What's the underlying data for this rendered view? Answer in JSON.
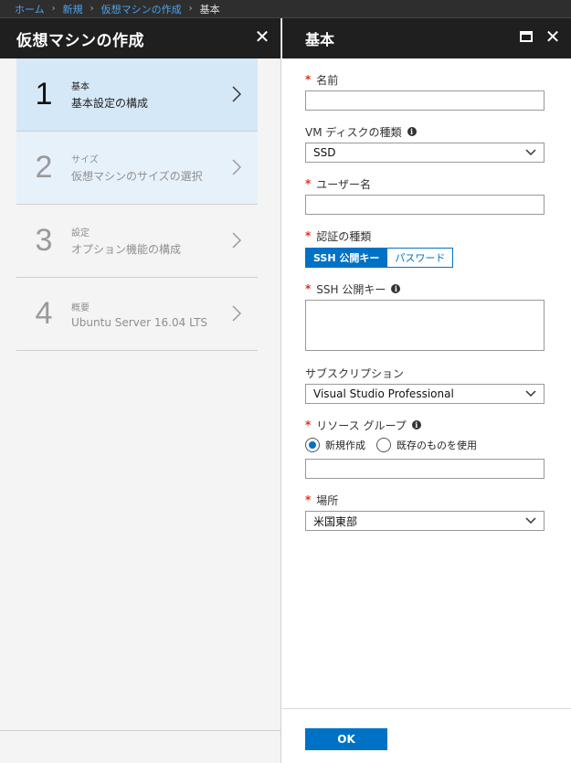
{
  "breadcrumb": {
    "items": [
      "ホーム",
      "新規",
      "仮想マシンの作成"
    ],
    "current": "基本"
  },
  "left_blade": {
    "title": "仮想マシンの作成",
    "steps": [
      {
        "number": "1",
        "title": "基本",
        "subtitle": "基本設定の構成",
        "state": "active"
      },
      {
        "number": "2",
        "title": "サイズ",
        "subtitle": "仮想マシンのサイズの選択",
        "state": "upcoming"
      },
      {
        "number": "3",
        "title": "設定",
        "subtitle": "オプション機能の構成",
        "state": "upcoming"
      },
      {
        "number": "4",
        "title": "概要",
        "subtitle": "Ubuntu Server 16.04 LTS",
        "state": "upcoming"
      }
    ]
  },
  "right_blade": {
    "title": "基本",
    "fields": {
      "name": {
        "label": "名前",
        "value": ""
      },
      "vm_disk_type": {
        "label": "VM ディスクの種類",
        "value": "SSD"
      },
      "username": {
        "label": "ユーザー名",
        "value": ""
      },
      "auth_type": {
        "label": "認証の種類",
        "options": [
          "SSH 公開キー",
          "パスワード"
        ],
        "selected": "SSH 公開キー"
      },
      "ssh_key": {
        "label": "SSH 公開キー",
        "value": ""
      },
      "subscription": {
        "label": "サブスクリプション",
        "value": "Visual Studio Professional"
      },
      "resource_group": {
        "label": "リソース グループ",
        "options": [
          "新規作成",
          "既存のものを使用"
        ],
        "selected": "新規作成",
        "value": ""
      },
      "location": {
        "label": "場所",
        "value": "米国東部"
      }
    },
    "ok_label": "OK"
  },
  "colors": {
    "accent": "#0072c6",
    "required": "#e0301e",
    "header_bg": "#1f1f1f",
    "active_step_bg": "#d5e8f7"
  }
}
